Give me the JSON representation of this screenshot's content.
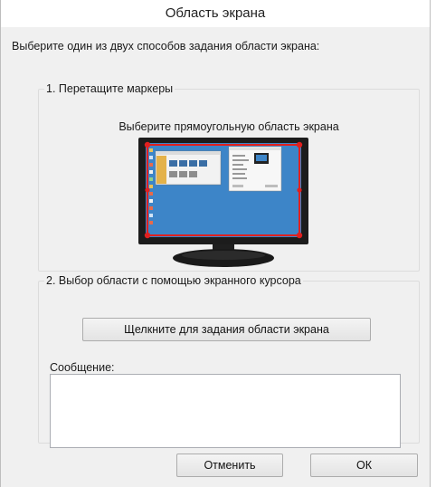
{
  "window": {
    "title": "Область экрана"
  },
  "instruction": "Выберите один из двух способов задания области экрана:",
  "group_markers": {
    "legend": "1. Перетащите маркеры",
    "caption": "Выберите прямоугольную область экрана"
  },
  "group_cursor": {
    "legend": "2. Выбор области с помощью экранного курсора",
    "select_button": "Щелкните для задания области экрана",
    "message_label": "Сообщение:",
    "message_value": ""
  },
  "buttons": {
    "cancel": "Отменить",
    "ok": "ОК"
  },
  "colors": {
    "desktop": "#3d85c8",
    "selection": "#e0201f",
    "monitor_bezel": "#1c1c1c",
    "dialog_bg": "#f0f0f0"
  }
}
